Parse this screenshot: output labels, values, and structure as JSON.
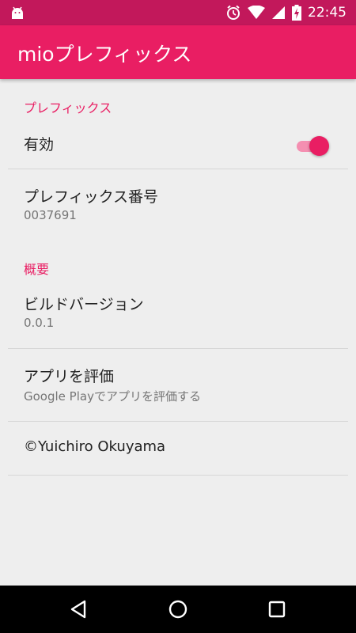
{
  "status_bar": {
    "time": "22:45",
    "icons": [
      "android-icon",
      "alarm-icon",
      "wifi-icon",
      "signal-icon",
      "battery-charging-icon"
    ]
  },
  "app_bar": {
    "title": "mioプレフィックス"
  },
  "sections": {
    "prefix_header": "プレフィックス",
    "about_header": "概要"
  },
  "settings": {
    "enabled": {
      "title": "有効",
      "value": true
    },
    "prefix_number": {
      "title": "プレフィックス番号",
      "value": "0037691"
    },
    "build_version": {
      "title": "ビルドバージョン",
      "value": "0.0.1"
    },
    "rate_app": {
      "title": "アプリを評価",
      "summary": "Google Playでアプリを評価する"
    },
    "copyright": {
      "title": "©Yuichiro Okuyama"
    }
  },
  "colors": {
    "status_bar": "#c2185b",
    "app_bar": "#e91e63",
    "accent": "#e91e63",
    "background": "#eeeeee"
  },
  "nav_bar": {
    "icons": [
      "back-icon",
      "home-icon",
      "recents-icon"
    ]
  }
}
